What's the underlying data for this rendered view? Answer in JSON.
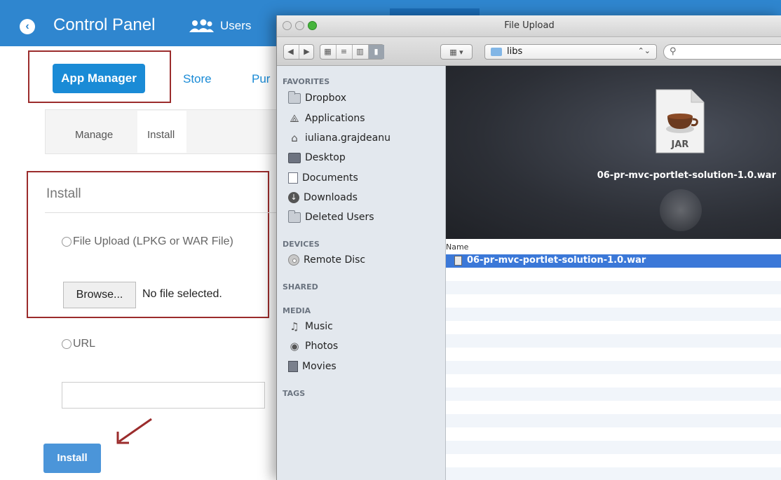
{
  "control_panel": {
    "title": "Control Panel",
    "users_label": "Users",
    "tabs": [
      {
        "label": "App Manager"
      },
      {
        "label": "Store"
      },
      {
        "label": "Pur"
      }
    ],
    "subtabs": [
      {
        "label": "Manage"
      },
      {
        "label": "Install"
      }
    ],
    "install_section": {
      "heading": "Install",
      "file_upload_label": "File Upload (LPKG or WAR File)",
      "browse_label": "Browse...",
      "no_file_text": "No file selected.",
      "url_label": "URL",
      "url_value": "",
      "install_button_label": "Install"
    },
    "colors": {
      "header": "#2f86cf",
      "accent": "#1a8bd6",
      "highlight_border": "#9b2c2c"
    }
  },
  "file_dialog": {
    "title": "File Upload",
    "current_folder": "libs",
    "search_value": "",
    "sidebar": {
      "favorites_label": "FAVORITES",
      "favorites": [
        {
          "label": "Dropbox",
          "icon": "folder-icon"
        },
        {
          "label": "Applications",
          "icon": "applications-icon"
        },
        {
          "label": "iuliana.grajdeanu",
          "icon": "home-icon"
        },
        {
          "label": "Desktop",
          "icon": "desktop-icon"
        },
        {
          "label": "Documents",
          "icon": "documents-icon"
        },
        {
          "label": "Downloads",
          "icon": "downloads-icon"
        },
        {
          "label": "Deleted Users",
          "icon": "folder-icon"
        }
      ],
      "devices_label": "DEVICES",
      "devices": [
        {
          "label": "Remote Disc",
          "icon": "disc-icon"
        }
      ],
      "shared_label": "SHARED",
      "media_label": "MEDIA",
      "media": [
        {
          "label": "Music",
          "icon": "music-icon"
        },
        {
          "label": "Photos",
          "icon": "camera-icon"
        },
        {
          "label": "Movies",
          "icon": "film-icon"
        }
      ],
      "tags_label": "TAGS"
    },
    "preview": {
      "icon_label": "JAR",
      "file_name": "06-pr-mvc-portlet-solution-1.0.war"
    },
    "list": {
      "column_name": "Name",
      "files": [
        {
          "name": "06-pr-mvc-portlet-solution-1.0.war",
          "selected": true
        }
      ]
    },
    "colors": {
      "selection": "#3b78d8",
      "sidebar_bg": "#e3e8ee"
    }
  }
}
